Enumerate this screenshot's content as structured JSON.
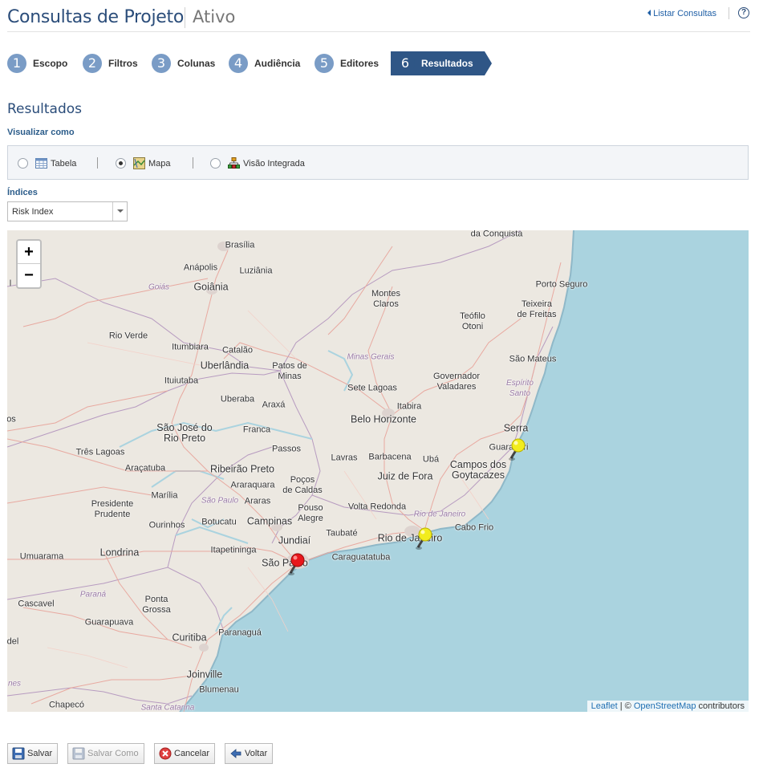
{
  "header": {
    "title": "Consultas de Projeto",
    "status": "Ativo",
    "list_link": "Listar Consultas",
    "help": "?"
  },
  "steps": [
    {
      "num": "1",
      "label": "Escopo"
    },
    {
      "num": "2",
      "label": "Filtros"
    },
    {
      "num": "3",
      "label": "Colunas"
    },
    {
      "num": "4",
      "label": "Audiência"
    },
    {
      "num": "5",
      "label": "Editores"
    },
    {
      "num": "6",
      "label": "Resultados"
    }
  ],
  "active_step": 6,
  "section_title": "Resultados",
  "visualize": {
    "label": "Visualizar como",
    "options": [
      "Tabela",
      "Mapa",
      "Visão Integrada"
    ],
    "selected": "Mapa"
  },
  "indices": {
    "label": "Índices",
    "selected": "Risk Index"
  },
  "map": {
    "zoom_in": "+",
    "zoom_out": "−",
    "attribution": {
      "leaflet": "Leaflet",
      "sep": " | © ",
      "osm": "OpenStreetMap",
      "suffix": " contributors"
    },
    "places": {
      "brasilia": "Brasília",
      "anapolis": "Anápolis",
      "luziania": "Luziânia",
      "goias": "Goiás",
      "goiania": "Goiânia",
      "rio_verde": "Rio Verde",
      "itumbiara": "Itumbiara",
      "catalao": "Catalão",
      "uberlandia": "Uberlândia",
      "ituiutaba": "Ituiutaba",
      "uberaba": "Uberaba",
      "araxa": "Araxá",
      "patos": "Patos de\nMinas",
      "montes_claros": "Montes\nClaros",
      "minas_gerais": "Minas Gerais",
      "teofilo": "Teófilo\nOtoni",
      "porto_seguro": "Porto Seguro",
      "teixeira": "Teixeira\nde Freitas",
      "sao_mateus": "São Mateus",
      "governador": "Governador\nValadares",
      "espirito_santo": "Espírito\nSanto",
      "sete_lagoas": "Sete Lagoas",
      "itabira": "Itabira",
      "belo_horizonte": "Belo Horizonte",
      "serra": "Serra",
      "guarapari": "Guarapari",
      "sao_jose": "São José do\nRio Preto",
      "franca": "Franca",
      "passos": "Passos",
      "tres_lagoas": "Três Lagoas",
      "aracatuba": "Araçatuba",
      "ribeirao": "Ribeirão Preto",
      "araraquara": "Araraquara",
      "pocos": "Poços\nde Caldas",
      "lavras": "Lavras",
      "barbacena": "Barbacena",
      "uba": "Ubá",
      "juiz_de_fora": "Juiz de Fora",
      "campos": "Campos dos\nGoytacazes",
      "marilia": "Marília",
      "sao_paulo_state": "São Paulo",
      "araras": "Araras",
      "pouso_alegre": "Pouso\nAlegre",
      "volta_redonda": "Volta Redonda",
      "rio_state": "Rio de Janeiro",
      "presidente": "Presidente\nPrudente",
      "ourinhos": "Ourinhos",
      "botucatu": "Botucatu",
      "campinas": "Campinas",
      "taubate": "Taubaté",
      "rio": "Rio de Janeiro",
      "cabo_frio": "Cabo Frio",
      "umuarama": "Umuarama",
      "londrina": "Londrina",
      "itapetininga": "Itapetininga",
      "jundiai": "Jundiaí",
      "sao_paulo": "São Paulo",
      "caraguatatuba": "Caraguatatuba",
      "parana": "Paraná",
      "cascavel": "Cascavel",
      "ponta_grossa": "Ponta\nGrossa",
      "guarapuava": "Guarapuava",
      "curitiba": "Curitiba",
      "paranagua": "Paranaguá",
      "joinville": "Joinville",
      "blumenau": "Blumenau",
      "chapeco": "Chapecó",
      "santa_catarina": "Santa Catarina",
      "da_conquista": "da Conquista",
      "del": "del",
      "nes": "nes",
      "os": "os",
      "l": "l"
    },
    "markers": [
      {
        "color": "#f2ec1e",
        "place": "Guarapari"
      },
      {
        "color": "#f2ec1e",
        "place": "Rio de Janeiro"
      },
      {
        "color": "#e8171c",
        "place": "São Paulo"
      }
    ]
  },
  "buttons": {
    "save": "Salvar",
    "save_as": "Salvar Como",
    "cancel": "Cancelar",
    "back": "Voltar"
  }
}
